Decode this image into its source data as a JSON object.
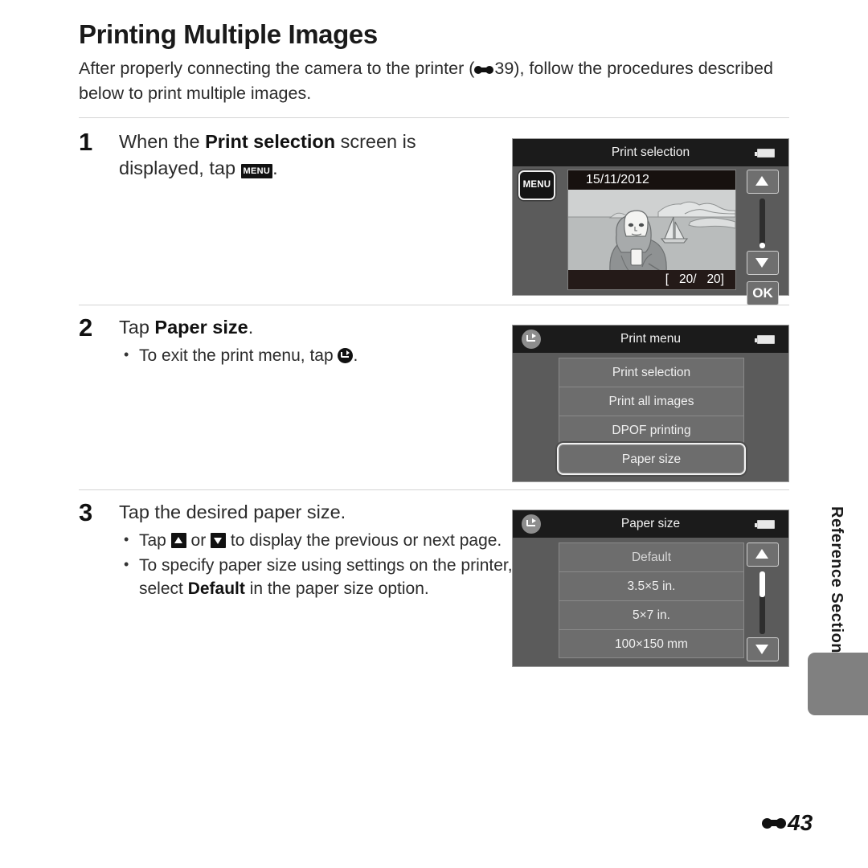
{
  "document": {
    "title": "Printing Multiple Images",
    "intro_part1": "After properly connecting the camera to the printer (",
    "intro_ref_icon": "nikon-dumbbell-icon",
    "intro_ref_page": "39",
    "intro_part2": "), follow the procedures described below to print multiple images.",
    "folio_icon": "nikon-dumbbell-icon",
    "folio_page": "43",
    "side_tab_label": "Reference Section"
  },
  "steps": [
    {
      "number": "1",
      "text_part1": "When the ",
      "text_bold": "Print selection",
      "text_part2": " screen is displayed, tap ",
      "menu_icon_label": "MENU",
      "text_end": "."
    },
    {
      "number": "2",
      "text_part1": "Tap ",
      "text_bold": "Paper size",
      "text_end": ".",
      "bullets": [
        {
          "part1": "To exit the print menu, tap ",
          "icon": "back-arrow-icon",
          "part2": "."
        }
      ]
    },
    {
      "number": "3",
      "text_part1": "Tap the desired paper size.",
      "bullets": [
        {
          "part1": "Tap ",
          "icon_up": "up-arrow-icon",
          "mid": " or ",
          "icon_down": "down-arrow-icon",
          "part2": " to display the previous or next page."
        },
        {
          "part1": "To specify paper size using settings on the printer, select ",
          "bold": "Default",
          "part2": " in the paper size option."
        }
      ]
    }
  ],
  "screens": {
    "print_selection": {
      "title": "Print selection",
      "battery_icon": "battery-full-icon",
      "menu_button_label": "MENU",
      "photo_date": "15/11/2012",
      "photo_counter": "[   20/   20]",
      "up_button": "up-arrow-icon",
      "down_button": "down-arrow-icon",
      "ok_button_label": "OK"
    },
    "print_menu": {
      "title": "Print menu",
      "battery_icon": "battery-full-icon",
      "back_button": "back-arrow-icon",
      "items": [
        {
          "label": "Print selection",
          "selected": false
        },
        {
          "label": "Print all images",
          "selected": false
        },
        {
          "label": "DPOF printing",
          "selected": false
        },
        {
          "label": "Paper size",
          "selected": true
        }
      ]
    },
    "paper_size": {
      "title": "Paper size",
      "battery_icon": "battery-full-icon",
      "back_button": "back-arrow-icon",
      "items": [
        {
          "label": "Default",
          "dim": true
        },
        {
          "label": "3.5×5 in.",
          "dim": false
        },
        {
          "label": "5×7 in.",
          "dim": false
        },
        {
          "label": "100×150 mm",
          "dim": false
        }
      ],
      "up_button": "up-arrow-icon",
      "down_button": "down-arrow-icon"
    }
  },
  "colors": {
    "lcd_body": "#5b5b5b",
    "lcd_bar": "#1b1b1b",
    "list_item": "#6d6d6d",
    "tab_gray": "#808080",
    "rule": "#d4d4d4"
  }
}
